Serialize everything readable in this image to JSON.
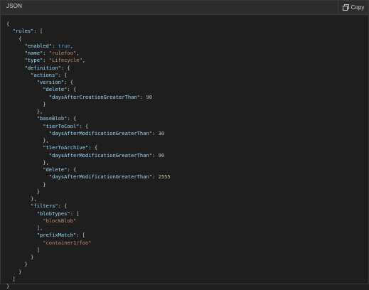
{
  "header": {
    "language_label": "JSON",
    "copy_label": "Copy",
    "copy_icon": "copy-icon"
  },
  "colors": {
    "background": "#1e1e1e",
    "header_background": "#2d2d2d",
    "key": "#9cdcfe",
    "string": "#ce9178",
    "number": "#b5cea8",
    "boolean": "#569cd6",
    "punctuation": "#d4d4d4"
  },
  "code": {
    "lines": [
      [
        {
          "t": "punct",
          "v": "{"
        }
      ],
      [
        {
          "t": "indent",
          "v": "  "
        },
        {
          "t": "key",
          "v": "\"rules\""
        },
        {
          "t": "punct",
          "v": ": ["
        }
      ],
      [
        {
          "t": "indent",
          "v": "    "
        },
        {
          "t": "punct",
          "v": "{"
        }
      ],
      [
        {
          "t": "indent",
          "v": "      "
        },
        {
          "t": "key",
          "v": "\"enabled\""
        },
        {
          "t": "punct",
          "v": ": "
        },
        {
          "t": "bool",
          "v": "true"
        },
        {
          "t": "punct",
          "v": ","
        }
      ],
      [
        {
          "t": "indent",
          "v": "      "
        },
        {
          "t": "key",
          "v": "\"name\""
        },
        {
          "t": "punct",
          "v": ": "
        },
        {
          "t": "string",
          "v": "\"rulefoo\""
        },
        {
          "t": "punct",
          "v": ","
        }
      ],
      [
        {
          "t": "indent",
          "v": "      "
        },
        {
          "t": "key",
          "v": "\"type\""
        },
        {
          "t": "punct",
          "v": ": "
        },
        {
          "t": "string",
          "v": "\"Lifecycle\""
        },
        {
          "t": "punct",
          "v": ","
        }
      ],
      [
        {
          "t": "indent",
          "v": "      "
        },
        {
          "t": "key",
          "v": "\"definition\""
        },
        {
          "t": "punct",
          "v": ": {"
        }
      ],
      [
        {
          "t": "indent",
          "v": "        "
        },
        {
          "t": "key",
          "v": "\"actions\""
        },
        {
          "t": "punct",
          "v": ": {"
        }
      ],
      [
        {
          "t": "indent",
          "v": "          "
        },
        {
          "t": "key",
          "v": "\"version\""
        },
        {
          "t": "punct",
          "v": ": {"
        }
      ],
      [
        {
          "t": "indent",
          "v": "            "
        },
        {
          "t": "key",
          "v": "\"delete\""
        },
        {
          "t": "punct",
          "v": ": {"
        }
      ],
      [
        {
          "t": "indent",
          "v": "              "
        },
        {
          "t": "key",
          "v": "\"daysAfterCreationGreaterThan\""
        },
        {
          "t": "punct",
          "v": ": "
        },
        {
          "t": "number",
          "v": "90"
        }
      ],
      [
        {
          "t": "indent",
          "v": "            "
        },
        {
          "t": "punct",
          "v": "}"
        }
      ],
      [
        {
          "t": "indent",
          "v": "          "
        },
        {
          "t": "punct",
          "v": "},"
        }
      ],
      [
        {
          "t": "indent",
          "v": "          "
        },
        {
          "t": "key",
          "v": "\"baseBlob\""
        },
        {
          "t": "punct",
          "v": ": {"
        }
      ],
      [
        {
          "t": "indent",
          "v": "            "
        },
        {
          "t": "key",
          "v": "\"tierToCool\""
        },
        {
          "t": "punct",
          "v": ": {"
        }
      ],
      [
        {
          "t": "indent",
          "v": "              "
        },
        {
          "t": "key",
          "v": "\"daysAfterModificationGreaterThan\""
        },
        {
          "t": "punct",
          "v": ": "
        },
        {
          "t": "number",
          "v": "30"
        }
      ],
      [
        {
          "t": "indent",
          "v": "            "
        },
        {
          "t": "punct",
          "v": "},"
        }
      ],
      [
        {
          "t": "indent",
          "v": "            "
        },
        {
          "t": "key",
          "v": "\"tierToArchive\""
        },
        {
          "t": "punct",
          "v": ": {"
        }
      ],
      [
        {
          "t": "indent",
          "v": "              "
        },
        {
          "t": "key",
          "v": "\"daysAfterModificationGreaterThan\""
        },
        {
          "t": "punct",
          "v": ": "
        },
        {
          "t": "number",
          "v": "90"
        }
      ],
      [
        {
          "t": "indent",
          "v": "            "
        },
        {
          "t": "punct",
          "v": "},"
        }
      ],
      [
        {
          "t": "indent",
          "v": "            "
        },
        {
          "t": "key",
          "v": "\"delete\""
        },
        {
          "t": "punct",
          "v": ": {"
        }
      ],
      [
        {
          "t": "indent",
          "v": "              "
        },
        {
          "t": "key",
          "v": "\"daysAfterModificationGreaterThan\""
        },
        {
          "t": "punct",
          "v": ": "
        },
        {
          "t": "number",
          "v": "2555"
        }
      ],
      [
        {
          "t": "indent",
          "v": "            "
        },
        {
          "t": "punct",
          "v": "}"
        }
      ],
      [
        {
          "t": "indent",
          "v": "          "
        },
        {
          "t": "punct",
          "v": "}"
        }
      ],
      [
        {
          "t": "indent",
          "v": "        "
        },
        {
          "t": "punct",
          "v": "},"
        }
      ],
      [
        {
          "t": "indent",
          "v": "        "
        },
        {
          "t": "key",
          "v": "\"filters\""
        },
        {
          "t": "punct",
          "v": ": {"
        }
      ],
      [
        {
          "t": "indent",
          "v": "          "
        },
        {
          "t": "key",
          "v": "\"blobTypes\""
        },
        {
          "t": "punct",
          "v": ": ["
        }
      ],
      [
        {
          "t": "indent",
          "v": "            "
        },
        {
          "t": "string",
          "v": "\"blockBlob\""
        }
      ],
      [
        {
          "t": "indent",
          "v": "          "
        },
        {
          "t": "punct",
          "v": "],"
        }
      ],
      [
        {
          "t": "indent",
          "v": "          "
        },
        {
          "t": "key",
          "v": "\"prefixMatch\""
        },
        {
          "t": "punct",
          "v": ": ["
        }
      ],
      [
        {
          "t": "indent",
          "v": "            "
        },
        {
          "t": "string",
          "v": "\"container1/foo\""
        }
      ],
      [
        {
          "t": "indent",
          "v": "          "
        },
        {
          "t": "punct",
          "v": "]"
        }
      ],
      [
        {
          "t": "indent",
          "v": "        "
        },
        {
          "t": "punct",
          "v": "}"
        }
      ],
      [
        {
          "t": "indent",
          "v": "      "
        },
        {
          "t": "punct",
          "v": "}"
        }
      ],
      [
        {
          "t": "indent",
          "v": "    "
        },
        {
          "t": "punct",
          "v": "}"
        }
      ],
      [
        {
          "t": "indent",
          "v": "  "
        },
        {
          "t": "punct",
          "v": "]"
        }
      ],
      [
        {
          "t": "punct",
          "v": "}"
        }
      ]
    ]
  }
}
